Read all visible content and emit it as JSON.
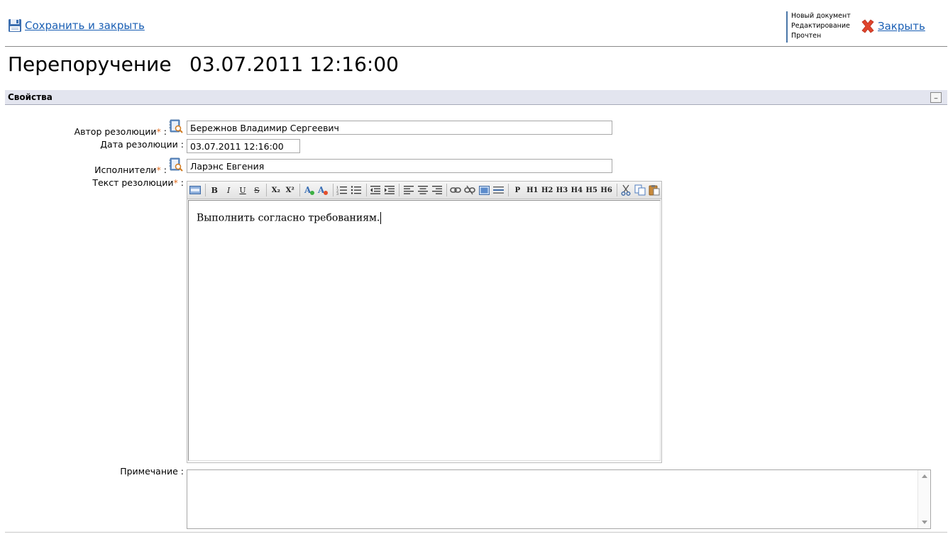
{
  "header": {
    "save_close_label": "Сохранить и закрыть",
    "status_lines": [
      "Новый документ",
      "Редактирование",
      "Прочтен"
    ],
    "close_label": "Закрыть"
  },
  "title": {
    "doc_type": "Перепоручение",
    "datetime": "03.07.2011 12:16:00"
  },
  "section": {
    "label": "Свойства",
    "collapse_symbol": "_"
  },
  "form": {
    "author_label": "Автор резолюции",
    "author_value": "Бережнов Владимир Сергеевич",
    "date_label": "Дата резолюции :",
    "date_value": "03.07.2011 12:16:00",
    "executors_label": "Исполнители",
    "executors_value": "Ларэнс Евгения",
    "text_label": "Текст резолюции",
    "text_value": "Выполнить согласно требованиям.",
    "note_label": "Примечание :",
    "note_value": "",
    "required_mark": "*",
    "colon": " :"
  },
  "toolbar_text": {
    "bold": "B",
    "italic": "I",
    "underline": "U",
    "strike": "S",
    "sub": "X₂",
    "sup": "X²",
    "p": "P",
    "h1": "H1",
    "h2": "H2",
    "h3": "H3",
    "h4": "H4",
    "h5": "H5",
    "h6": "H6"
  },
  "colors": {
    "link": "#1a5fb4",
    "required": "#e06a1c",
    "section_bg": "#e3e5ef",
    "status_bar": "#4a76a8",
    "close_x": "#e0442c"
  }
}
